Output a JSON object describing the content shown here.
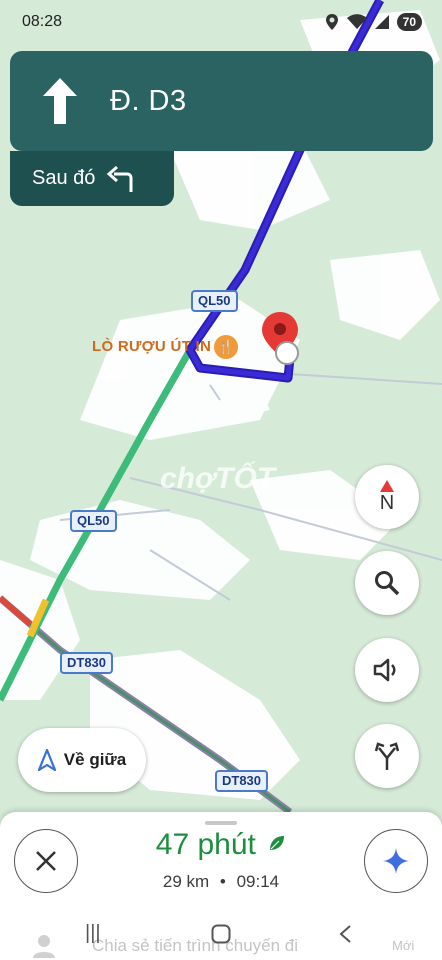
{
  "status_bar": {
    "time": "08:28",
    "battery": "70"
  },
  "navigation": {
    "street": "Đ. D3",
    "then_label": "Sau đó"
  },
  "map": {
    "road_labels": [
      "QL50",
      "QL50",
      "DT830",
      "DT830"
    ],
    "poi_label": "LÒ RƯỢU ÚT IN",
    "watermark": "chợTỐT"
  },
  "controls": {
    "compass_label": "N",
    "recenter_label": "Về giữa"
  },
  "trip": {
    "duration": "47 phút",
    "distance": "29 km",
    "arrival": "09:14",
    "separator": "•"
  },
  "share": {
    "label": "Chia sẻ tiến trình chuyến đi",
    "more": "Mới"
  },
  "colors": {
    "banner": "#2b6363",
    "route": "#3a2ad8",
    "traffic_green": "#3dbb7a",
    "eta_green": "#1e8e3e",
    "destination_pin": "#e53935"
  }
}
